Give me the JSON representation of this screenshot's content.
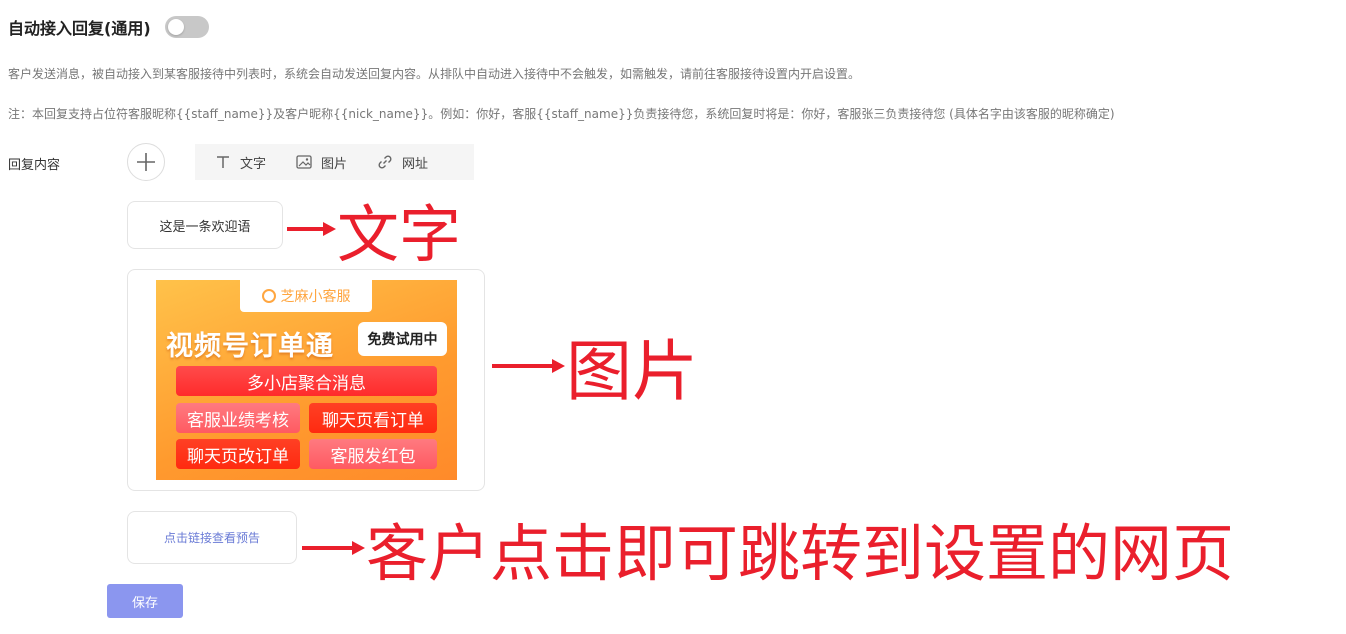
{
  "header": {
    "title": "自动接入回复(通用)",
    "toggle_on": false
  },
  "descriptions": {
    "line1": "客户发送消息，被自动接入到某客服接待中列表时，系统会自动发送回复内容。从排队中自动进入接待中不会触发，如需触发，请前往客服接待设置内开启设置。",
    "line2": "注：本回复支持占位符客服昵称{{staff_name}}及客户昵称{{nick_name}}。例如：你好，客服{{staff_name}}负责接待您，系统回复时将是：你好，客服张三负责接待您 (具体名字由该客服的昵称确定)"
  },
  "reply": {
    "label": "回复内容",
    "toolbar": {
      "items": [
        {
          "label": "文字",
          "icon": "text-icon"
        },
        {
          "label": "图片",
          "icon": "image-icon"
        },
        {
          "label": "网址",
          "icon": "link-icon"
        }
      ]
    },
    "text_message": "这是一条欢迎语",
    "image_message": {
      "brand": "芝麻小客服",
      "headline": "视频号订单通",
      "badge": "免费试用中",
      "features": [
        "多小店聚合消息",
        "客服业绩考核",
        "聊天页看订单",
        "聊天页改订单",
        "客服发红包"
      ]
    },
    "link_message": "点击链接查看预告"
  },
  "save_label": "保存",
  "annotations": {
    "text": "文字",
    "image": "图片",
    "link": "客户点击即可跳转到设置的网页",
    "color": "#ea1f2c"
  },
  "colors": {
    "primary_button": "#8b96ef",
    "link_text": "#6a7bd6",
    "banner_orange": "#ff9a2e"
  }
}
